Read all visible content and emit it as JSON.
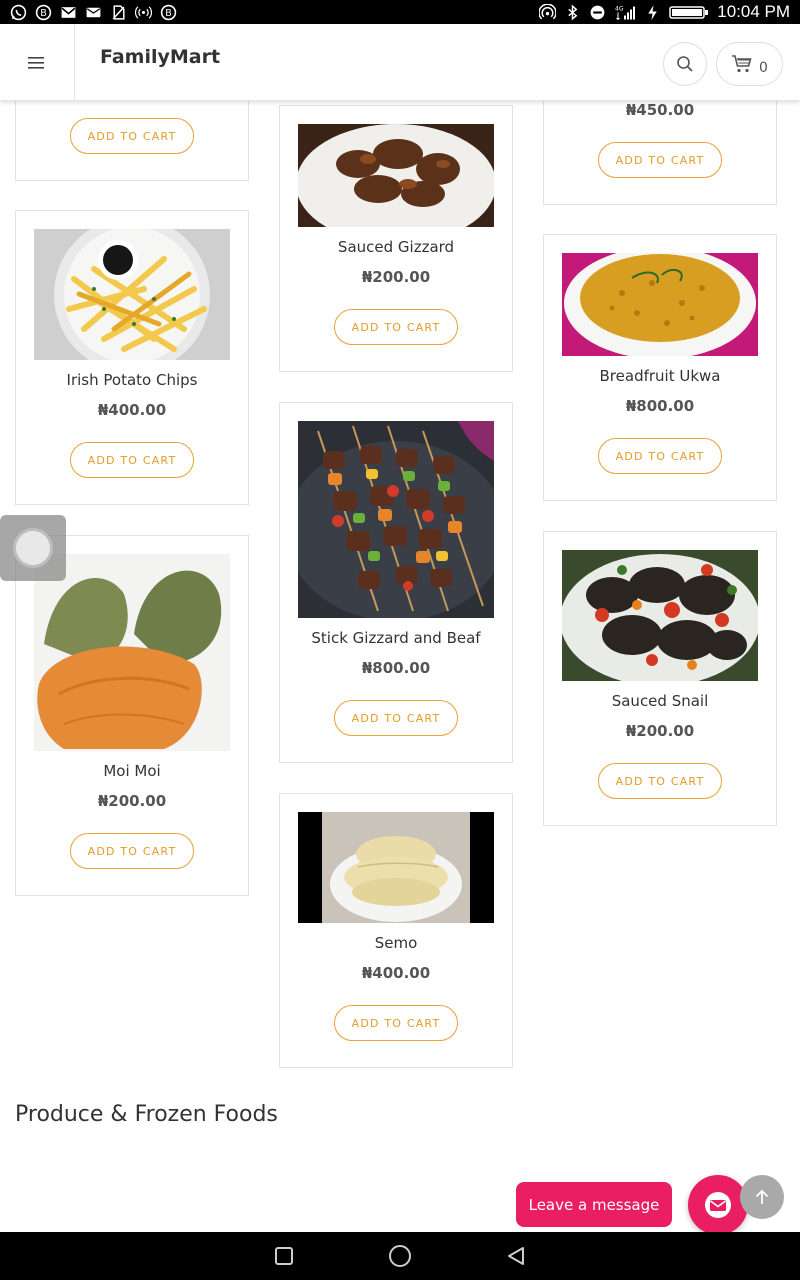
{
  "status_bar": {
    "time": "10:04 PM",
    "network": "4G",
    "left_icons": [
      "whatsapp-icon",
      "b-app-icon",
      "gmail-icon",
      "mail-icon",
      "no-sim-icon",
      "broadcast-icon",
      "b-app-icon"
    ],
    "right_icons": [
      "hotspot-icon",
      "bluetooth-icon",
      "dnd-icon",
      "signal-icon",
      "charging-icon",
      "battery-icon"
    ]
  },
  "header": {
    "brand": "FamilyMart",
    "cart_count": "0"
  },
  "products": [
    {
      "id": "c1-top",
      "name": "",
      "price": "",
      "button": "ADD TO CART"
    },
    {
      "id": "irish-potato-chips",
      "name": "Irish Potato Chips",
      "price": "₦400.00",
      "button": "ADD TO CART"
    },
    {
      "id": "moi-moi",
      "name": "Moi Moi",
      "price": "₦200.00",
      "button": "ADD TO CART"
    },
    {
      "id": "sauced-gizzard",
      "name": "Sauced Gizzard",
      "price": "₦200.00",
      "button": "ADD TO CART"
    },
    {
      "id": "stick-gizzard",
      "name": "Stick Gizzard and Beaf",
      "price": "₦800.00",
      "button": "ADD TO CART"
    },
    {
      "id": "semo",
      "name": "Semo",
      "price": "₦400.00",
      "button": "ADD TO CART"
    },
    {
      "id": "c3-top",
      "name": "",
      "price": "₦450.00",
      "button": "ADD TO CART"
    },
    {
      "id": "breadfruit-ukwa",
      "name": "Breadfruit Ukwa",
      "price": "₦800.00",
      "button": "ADD TO CART"
    },
    {
      "id": "sauced-snail",
      "name": "Sauced Snail",
      "price": "₦200.00",
      "button": "ADD TO CART"
    }
  ],
  "section": {
    "title": "Produce & Frozen Foods"
  },
  "chat": {
    "label": "Leave a message"
  },
  "colors": {
    "accent": "#e39b27",
    "chat": "#e91e63"
  }
}
